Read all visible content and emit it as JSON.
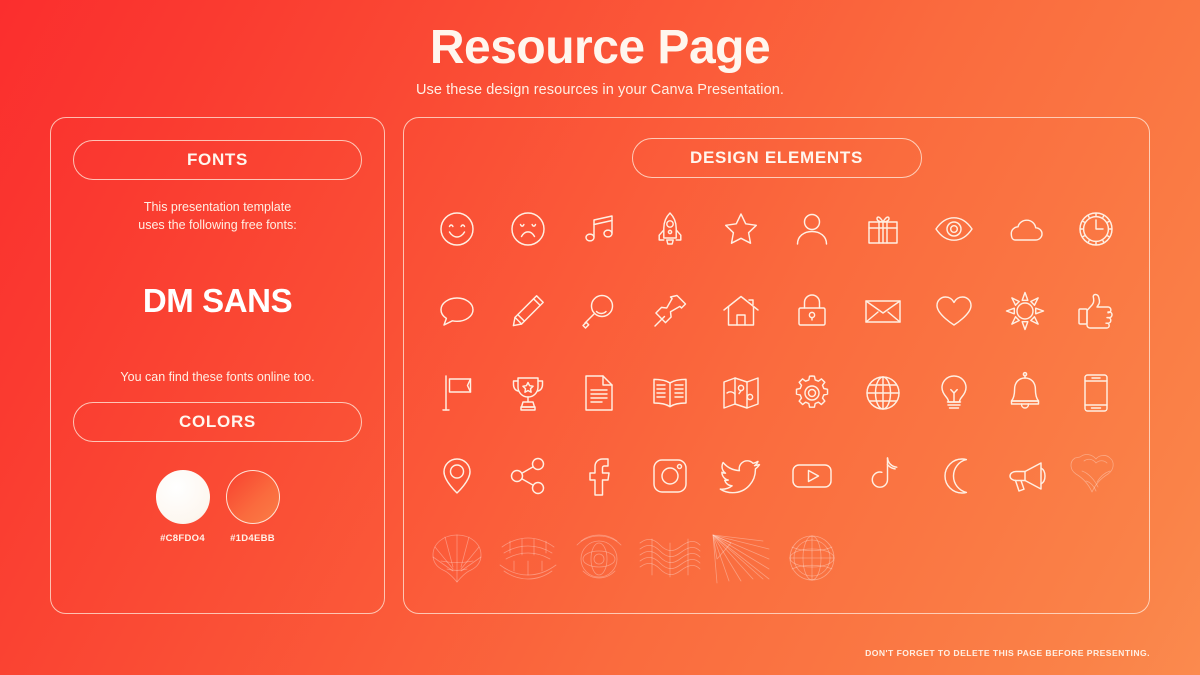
{
  "header": {
    "title": "Resource Page",
    "subtitle": "Use these design resources in your Canva Presentation."
  },
  "fonts_panel": {
    "heading": "FONTS",
    "description": "This presentation template\nuses the following free fonts:",
    "description_line1": "This presentation template",
    "description_line2": "uses the following free fonts:",
    "font_name": "DM SANS",
    "note": "You can find these fonts online too.",
    "colors_heading": "COLORS",
    "swatches": [
      {
        "name": "light-swatch",
        "code": "#C8FDO4",
        "color": "#FDF7F0"
      },
      {
        "name": "brand-swatch",
        "code": "#1D4EBB",
        "color": "#FA6B3E"
      }
    ]
  },
  "elements_panel": {
    "heading": "DESIGN ELEMENTS",
    "icons": [
      {
        "name": "smile-icon",
        "label": "Smiling Face"
      },
      {
        "name": "sad-face-icon",
        "label": "Sad Face"
      },
      {
        "name": "music-note-icon",
        "label": "Music Note"
      },
      {
        "name": "rocket-icon",
        "label": "Rocket"
      },
      {
        "name": "star-icon",
        "label": "Star"
      },
      {
        "name": "person-icon",
        "label": "Person"
      },
      {
        "name": "gift-icon",
        "label": "Gift"
      },
      {
        "name": "eye-icon",
        "label": "Eye"
      },
      {
        "name": "cloud-icon",
        "label": "Cloud"
      },
      {
        "name": "clock-icon",
        "label": "Clock"
      },
      {
        "name": "speech-bubble-icon",
        "label": "Speech Bubble"
      },
      {
        "name": "pencil-icon",
        "label": "Pencil"
      },
      {
        "name": "magnifier-icon",
        "label": "Magnifying Glass"
      },
      {
        "name": "pushpin-icon",
        "label": "Push Pin"
      },
      {
        "name": "house-icon",
        "label": "House"
      },
      {
        "name": "lock-icon",
        "label": "Lock"
      },
      {
        "name": "envelope-icon",
        "label": "Envelope"
      },
      {
        "name": "heart-icon",
        "label": "Heart"
      },
      {
        "name": "sun-icon",
        "label": "Sun"
      },
      {
        "name": "thumbs-up-icon",
        "label": "Thumbs Up"
      },
      {
        "name": "flag-icon",
        "label": "Flag"
      },
      {
        "name": "trophy-icon",
        "label": "Trophy"
      },
      {
        "name": "document-icon",
        "label": "Document"
      },
      {
        "name": "open-book-icon",
        "label": "Open Book"
      },
      {
        "name": "map-icon",
        "label": "Map"
      },
      {
        "name": "gear-icon",
        "label": "Gear"
      },
      {
        "name": "globe-icon",
        "label": "Globe"
      },
      {
        "name": "lightbulb-icon",
        "label": "Light Bulb"
      },
      {
        "name": "bell-icon",
        "label": "Bell"
      },
      {
        "name": "smartphone-icon",
        "label": "Smartphone"
      },
      {
        "name": "location-pin-icon",
        "label": "Location Pin"
      },
      {
        "name": "share-icon",
        "label": "Share"
      },
      {
        "name": "facebook-icon",
        "label": "Facebook"
      },
      {
        "name": "instagram-icon",
        "label": "Instagram"
      },
      {
        "name": "twitter-icon",
        "label": "Twitter"
      },
      {
        "name": "youtube-icon",
        "label": "YouTube"
      },
      {
        "name": "tiktok-icon",
        "label": "TikTok"
      },
      {
        "name": "moon-icon",
        "label": "Moon"
      },
      {
        "name": "megaphone-icon",
        "label": "Megaphone"
      },
      {
        "name": "abstract-blob-graphic",
        "label": "Abstract Blob"
      },
      {
        "name": "abstract-fan-graphic",
        "label": "Abstract Fan"
      },
      {
        "name": "abstract-mesh-graphic",
        "label": "Abstract Mesh"
      },
      {
        "name": "abstract-orb-graphic",
        "label": "Abstract Orb"
      },
      {
        "name": "abstract-wave-graphic",
        "label": "Abstract Wave"
      },
      {
        "name": "abstract-rays-graphic",
        "label": "Abstract Rays"
      },
      {
        "name": "abstract-sphere-graphic",
        "label": "Abstract Sphere"
      }
    ]
  },
  "footer": {
    "note": "DON'T FORGET TO DELETE THIS PAGE BEFORE PRESENTING."
  },
  "theme": {
    "gradient_start": "#FB2E2E",
    "gradient_end": "#FB8A4E",
    "stroke": "#FFEFE2",
    "text": "#FFF4EC"
  }
}
